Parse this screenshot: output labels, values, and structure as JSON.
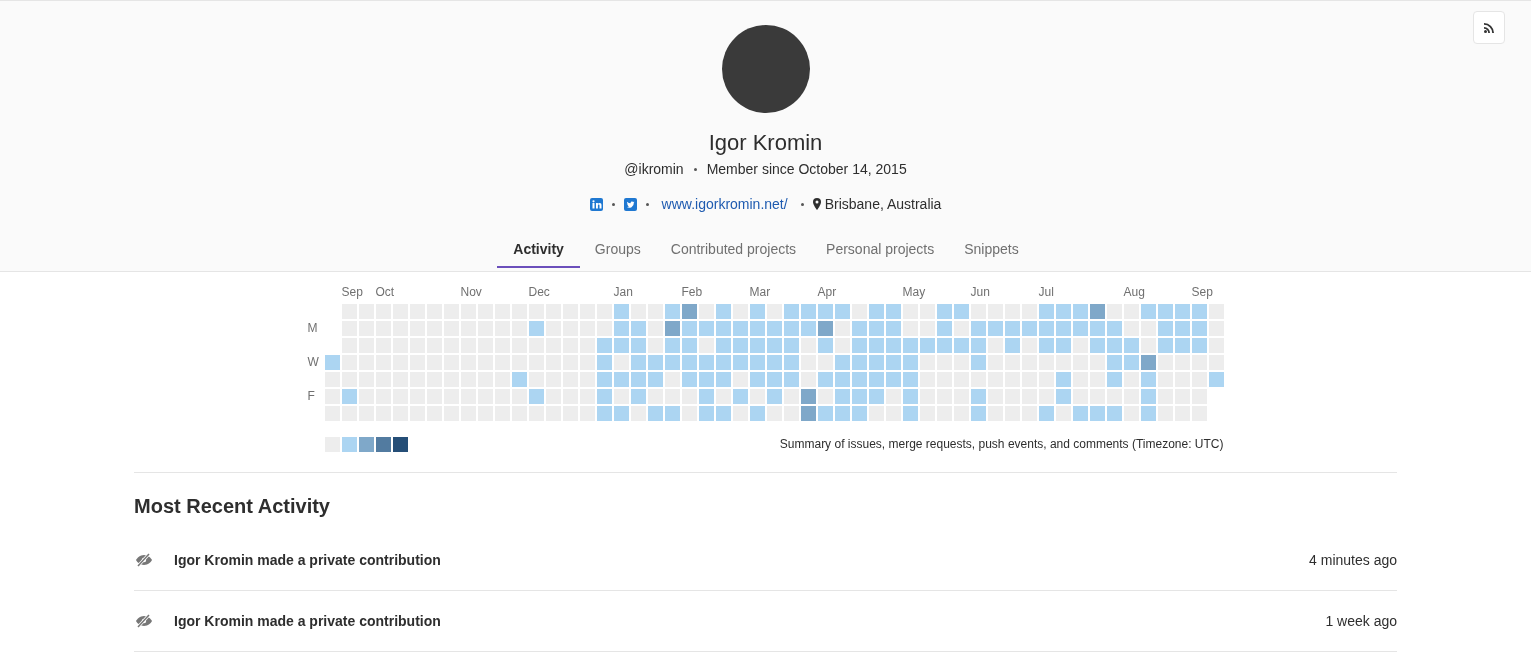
{
  "profile": {
    "name": "Igor Kromin",
    "username": "@ikromin",
    "member_since": "Member since October 14, 2015",
    "links": [
      {
        "kind": "linkedin"
      },
      {
        "kind": "twitter"
      },
      {
        "kind": "website",
        "text": "www.igorkromin.net/"
      },
      {
        "kind": "location",
        "text": "Brisbane, Australia"
      }
    ]
  },
  "tabs": [
    {
      "label": "Activity",
      "selected": true
    },
    {
      "label": "Groups",
      "selected": false
    },
    {
      "label": "Contributed projects",
      "selected": false
    },
    {
      "label": "Personal projects",
      "selected": false
    },
    {
      "label": "Snippets",
      "selected": false
    }
  ],
  "calendar": {
    "day_labels": [
      "M",
      "W",
      "F"
    ],
    "weeks": [
      {
        "days": [
          {
            "color": "#acd5f2"
          },
          {
            "color": "#ededed"
          },
          {
            "color": "#ededed"
          },
          {
            "color": "#ededed"
          }
        ]
      },
      {
        "month": "Sep",
        "days": [
          {
            "color": "#ededed"
          },
          {
            "color": "#ededed"
          },
          {
            "color": "#ededed"
          },
          {
            "color": "#ededed"
          },
          {
            "color": "#ededed"
          },
          {
            "color": "#acd5f2"
          },
          {
            "color": "#ededed"
          }
        ]
      },
      {
        "days": [
          {
            "color": "#ededed"
          },
          {
            "color": "#ededed"
          },
          {
            "color": "#ededed"
          },
          {
            "color": "#ededed"
          },
          {
            "color": "#ededed"
          },
          {
            "color": "#ededed"
          },
          {
            "color": "#ededed"
          }
        ]
      },
      {
        "month": "Oct",
        "days": [
          {
            "color": "#ededed"
          },
          {
            "color": "#ededed"
          },
          {
            "color": "#ededed"
          },
          {
            "color": "#ededed"
          },
          {
            "color": "#ededed"
          },
          {
            "color": "#ededed"
          },
          {
            "color": "#ededed"
          }
        ]
      },
      {
        "days": [
          {
            "color": "#ededed"
          },
          {
            "color": "#ededed"
          },
          {
            "color": "#ededed"
          },
          {
            "color": "#ededed"
          },
          {
            "color": "#ededed"
          },
          {
            "color": "#ededed"
          },
          {
            "color": "#ededed"
          }
        ]
      },
      {
        "days": [
          {
            "color": "#ededed"
          },
          {
            "color": "#ededed"
          },
          {
            "color": "#ededed"
          },
          {
            "color": "#ededed"
          },
          {
            "color": "#ededed"
          },
          {
            "color": "#ededed"
          },
          {
            "color": "#ededed"
          }
        ]
      },
      {
        "days": [
          {
            "color": "#ededed"
          },
          {
            "color": "#ededed"
          },
          {
            "color": "#ededed"
          },
          {
            "color": "#ededed"
          },
          {
            "color": "#ededed"
          },
          {
            "color": "#ededed"
          },
          {
            "color": "#ededed"
          }
        ]
      },
      {
        "days": [
          {
            "color": "#ededed"
          },
          {
            "color": "#ededed"
          },
          {
            "color": "#ededed"
          },
          {
            "color": "#ededed"
          },
          {
            "color": "#ededed"
          },
          {
            "color": "#ededed"
          },
          {
            "color": "#ededed"
          }
        ]
      },
      {
        "month": "Nov",
        "days": [
          {
            "color": "#ededed"
          },
          {
            "color": "#ededed"
          },
          {
            "color": "#ededed"
          },
          {
            "color": "#ededed"
          },
          {
            "color": "#ededed"
          },
          {
            "color": "#ededed"
          },
          {
            "color": "#ededed"
          }
        ]
      },
      {
        "days": [
          {
            "color": "#ededed"
          },
          {
            "color": "#ededed"
          },
          {
            "color": "#ededed"
          },
          {
            "color": "#ededed"
          },
          {
            "color": "#ededed"
          },
          {
            "color": "#ededed"
          },
          {
            "color": "#ededed"
          }
        ]
      },
      {
        "days": [
          {
            "color": "#ededed"
          },
          {
            "color": "#ededed"
          },
          {
            "color": "#ededed"
          },
          {
            "color": "#ededed"
          },
          {
            "color": "#ededed"
          },
          {
            "color": "#ededed"
          },
          {
            "color": "#ededed"
          }
        ]
      },
      {
        "days": [
          {
            "color": "#ededed"
          },
          {
            "color": "#ededed"
          },
          {
            "color": "#ededed"
          },
          {
            "color": "#ededed"
          },
          {
            "color": "#acd5f2"
          },
          {
            "color": "#ededed"
          },
          {
            "color": "#ededed"
          }
        ]
      },
      {
        "month": "Dec",
        "days": [
          {
            "color": "#ededed"
          },
          {
            "color": "#acd5f2"
          },
          {
            "color": "#ededed"
          },
          {
            "color": "#ededed"
          },
          {
            "color": "#ededed"
          },
          {
            "color": "#acd5f2"
          },
          {
            "color": "#ededed"
          }
        ]
      },
      {
        "days": [
          {
            "color": "#ededed"
          },
          {
            "color": "#ededed"
          },
          {
            "color": "#ededed"
          },
          {
            "color": "#ededed"
          },
          {
            "color": "#ededed"
          },
          {
            "color": "#ededed"
          },
          {
            "color": "#ededed"
          }
        ]
      },
      {
        "days": [
          {
            "color": "#ededed"
          },
          {
            "color": "#ededed"
          },
          {
            "color": "#ededed"
          },
          {
            "color": "#ededed"
          },
          {
            "color": "#ededed"
          },
          {
            "color": "#ededed"
          },
          {
            "color": "#ededed"
          }
        ]
      },
      {
        "days": [
          {
            "color": "#ededed"
          },
          {
            "color": "#ededed"
          },
          {
            "color": "#ededed"
          },
          {
            "color": "#ededed"
          },
          {
            "color": "#ededed"
          },
          {
            "color": "#ededed"
          },
          {
            "color": "#ededed"
          }
        ]
      },
      {
        "days": [
          {
            "color": "#ededed"
          },
          {
            "color": "#ededed"
          },
          {
            "color": "#acd5f2"
          },
          {
            "color": "#acd5f2"
          },
          {
            "color": "#acd5f2"
          },
          {
            "color": "#acd5f2"
          },
          {
            "color": "#acd5f2"
          }
        ]
      },
      {
        "month": "Jan",
        "days": [
          {
            "color": "#acd5f2"
          },
          {
            "color": "#acd5f2"
          },
          {
            "color": "#acd5f2"
          },
          {
            "color": "#ededed"
          },
          {
            "color": "#acd5f2"
          },
          {
            "color": "#ededed"
          },
          {
            "color": "#acd5f2"
          }
        ]
      },
      {
        "days": [
          {
            "color": "#ededed"
          },
          {
            "color": "#acd5f2"
          },
          {
            "color": "#acd5f2"
          },
          {
            "color": "#acd5f2"
          },
          {
            "color": "#acd5f2"
          },
          {
            "color": "#acd5f2"
          },
          {
            "color": "#ededed"
          }
        ]
      },
      {
        "days": [
          {
            "color": "#ededed"
          },
          {
            "color": "#ededed"
          },
          {
            "color": "#ededed"
          },
          {
            "color": "#acd5f2"
          },
          {
            "color": "#acd5f2"
          },
          {
            "color": "#ededed"
          },
          {
            "color": "#acd5f2"
          }
        ]
      },
      {
        "days": [
          {
            "color": "#acd5f2"
          },
          {
            "color": "#7fa8c9"
          },
          {
            "color": "#acd5f2"
          },
          {
            "color": "#acd5f2"
          },
          {
            "color": "#ededed"
          },
          {
            "color": "#ededed"
          },
          {
            "color": "#acd5f2"
          }
        ]
      },
      {
        "month": "Feb",
        "days": [
          {
            "color": "#7fa8c9"
          },
          {
            "color": "#acd5f2"
          },
          {
            "color": "#acd5f2"
          },
          {
            "color": "#acd5f2"
          },
          {
            "color": "#acd5f2"
          },
          {
            "color": "#ededed"
          },
          {
            "color": "#ededed"
          }
        ]
      },
      {
        "days": [
          {
            "color": "#ededed"
          },
          {
            "color": "#acd5f2"
          },
          {
            "color": "#ededed"
          },
          {
            "color": "#acd5f2"
          },
          {
            "color": "#acd5f2"
          },
          {
            "color": "#acd5f2"
          },
          {
            "color": "#acd5f2"
          }
        ]
      },
      {
        "days": [
          {
            "color": "#acd5f2"
          },
          {
            "color": "#acd5f2"
          },
          {
            "color": "#acd5f2"
          },
          {
            "color": "#acd5f2"
          },
          {
            "color": "#acd5f2"
          },
          {
            "color": "#ededed"
          },
          {
            "color": "#acd5f2"
          }
        ]
      },
      {
        "days": [
          {
            "color": "#ededed"
          },
          {
            "color": "#acd5f2"
          },
          {
            "color": "#acd5f2"
          },
          {
            "color": "#acd5f2"
          },
          {
            "color": "#ededed"
          },
          {
            "color": "#acd5f2"
          },
          {
            "color": "#ededed"
          }
        ]
      },
      {
        "month": "Mar",
        "days": [
          {
            "color": "#acd5f2"
          },
          {
            "color": "#acd5f2"
          },
          {
            "color": "#acd5f2"
          },
          {
            "color": "#acd5f2"
          },
          {
            "color": "#acd5f2"
          },
          {
            "color": "#ededed"
          },
          {
            "color": "#acd5f2"
          }
        ]
      },
      {
        "days": [
          {
            "color": "#ededed"
          },
          {
            "color": "#acd5f2"
          },
          {
            "color": "#acd5f2"
          },
          {
            "color": "#acd5f2"
          },
          {
            "color": "#acd5f2"
          },
          {
            "color": "#acd5f2"
          },
          {
            "color": "#ededed"
          }
        ]
      },
      {
        "days": [
          {
            "color": "#acd5f2"
          },
          {
            "color": "#acd5f2"
          },
          {
            "color": "#acd5f2"
          },
          {
            "color": "#acd5f2"
          },
          {
            "color": "#acd5f2"
          },
          {
            "color": "#ededed"
          },
          {
            "color": "#ededed"
          }
        ]
      },
      {
        "days": [
          {
            "color": "#acd5f2"
          },
          {
            "color": "#acd5f2"
          },
          {
            "color": "#ededed"
          },
          {
            "color": "#ededed"
          },
          {
            "color": "#ededed"
          },
          {
            "color": "#7fa8c9"
          },
          {
            "color": "#7fa8c9"
          }
        ]
      },
      {
        "month": "Apr",
        "days": [
          {
            "color": "#acd5f2"
          },
          {
            "color": "#7fa8c9"
          },
          {
            "color": "#acd5f2"
          },
          {
            "color": "#ededed"
          },
          {
            "color": "#acd5f2"
          },
          {
            "color": "#ededed"
          },
          {
            "color": "#acd5f2"
          }
        ]
      },
      {
        "days": [
          {
            "color": "#acd5f2"
          },
          {
            "color": "#ededed"
          },
          {
            "color": "#ededed"
          },
          {
            "color": "#acd5f2"
          },
          {
            "color": "#acd5f2"
          },
          {
            "color": "#acd5f2"
          },
          {
            "color": "#acd5f2"
          }
        ]
      },
      {
        "days": [
          {
            "color": "#ededed"
          },
          {
            "color": "#acd5f2"
          },
          {
            "color": "#acd5f2"
          },
          {
            "color": "#acd5f2"
          },
          {
            "color": "#acd5f2"
          },
          {
            "color": "#acd5f2"
          },
          {
            "color": "#acd5f2"
          }
        ]
      },
      {
        "days": [
          {
            "color": "#acd5f2"
          },
          {
            "color": "#acd5f2"
          },
          {
            "color": "#acd5f2"
          },
          {
            "color": "#acd5f2"
          },
          {
            "color": "#acd5f2"
          },
          {
            "color": "#acd5f2"
          },
          {
            "color": "#ededed"
          }
        ]
      },
      {
        "days": [
          {
            "color": "#acd5f2"
          },
          {
            "color": "#acd5f2"
          },
          {
            "color": "#acd5f2"
          },
          {
            "color": "#acd5f2"
          },
          {
            "color": "#acd5f2"
          },
          {
            "color": "#ededed"
          },
          {
            "color": "#ededed"
          }
        ]
      },
      {
        "month": "May",
        "days": [
          {
            "color": "#ededed"
          },
          {
            "color": "#ededed"
          },
          {
            "color": "#acd5f2"
          },
          {
            "color": "#acd5f2"
          },
          {
            "color": "#acd5f2"
          },
          {
            "color": "#acd5f2"
          },
          {
            "color": "#acd5f2"
          }
        ]
      },
      {
        "days": [
          {
            "color": "#ededed"
          },
          {
            "color": "#ededed"
          },
          {
            "color": "#acd5f2"
          },
          {
            "color": "#ededed"
          },
          {
            "color": "#ededed"
          },
          {
            "color": "#ededed"
          },
          {
            "color": "#ededed"
          }
        ]
      },
      {
        "days": [
          {
            "color": "#acd5f2"
          },
          {
            "color": "#acd5f2"
          },
          {
            "color": "#acd5f2"
          },
          {
            "color": "#ededed"
          },
          {
            "color": "#ededed"
          },
          {
            "color": "#ededed"
          },
          {
            "color": "#ededed"
          }
        ]
      },
      {
        "days": [
          {
            "color": "#acd5f2"
          },
          {
            "color": "#ededed"
          },
          {
            "color": "#acd5f2"
          },
          {
            "color": "#ededed"
          },
          {
            "color": "#ededed"
          },
          {
            "color": "#ededed"
          },
          {
            "color": "#ededed"
          }
        ]
      },
      {
        "month": "Jun",
        "days": [
          {
            "color": "#ededed"
          },
          {
            "color": "#acd5f2"
          },
          {
            "color": "#acd5f2"
          },
          {
            "color": "#acd5f2"
          },
          {
            "color": "#ededed"
          },
          {
            "color": "#acd5f2"
          },
          {
            "color": "#acd5f2"
          }
        ]
      },
      {
        "days": [
          {
            "color": "#ededed"
          },
          {
            "color": "#acd5f2"
          },
          {
            "color": "#ededed"
          },
          {
            "color": "#ededed"
          },
          {
            "color": "#ededed"
          },
          {
            "color": "#ededed"
          },
          {
            "color": "#ededed"
          }
        ]
      },
      {
        "days": [
          {
            "color": "#ededed"
          },
          {
            "color": "#acd5f2"
          },
          {
            "color": "#acd5f2"
          },
          {
            "color": "#ededed"
          },
          {
            "color": "#ededed"
          },
          {
            "color": "#ededed"
          },
          {
            "color": "#ededed"
          }
        ]
      },
      {
        "days": [
          {
            "color": "#ededed"
          },
          {
            "color": "#acd5f2"
          },
          {
            "color": "#ededed"
          },
          {
            "color": "#ededed"
          },
          {
            "color": "#ededed"
          },
          {
            "color": "#ededed"
          },
          {
            "color": "#ededed"
          }
        ]
      },
      {
        "month": "Jul",
        "days": [
          {
            "color": "#acd5f2"
          },
          {
            "color": "#acd5f2"
          },
          {
            "color": "#acd5f2"
          },
          {
            "color": "#ededed"
          },
          {
            "color": "#ededed"
          },
          {
            "color": "#ededed"
          },
          {
            "color": "#acd5f2"
          }
        ]
      },
      {
        "days": [
          {
            "color": "#acd5f2"
          },
          {
            "color": "#acd5f2"
          },
          {
            "color": "#acd5f2"
          },
          {
            "color": "#ededed"
          },
          {
            "color": "#acd5f2"
          },
          {
            "color": "#acd5f2"
          },
          {
            "color": "#ededed"
          }
        ]
      },
      {
        "days": [
          {
            "color": "#acd5f2"
          },
          {
            "color": "#acd5f2"
          },
          {
            "color": "#ededed"
          },
          {
            "color": "#ededed"
          },
          {
            "color": "#ededed"
          },
          {
            "color": "#ededed"
          },
          {
            "color": "#acd5f2"
          }
        ]
      },
      {
        "days": [
          {
            "color": "#7fa8c9"
          },
          {
            "color": "#acd5f2"
          },
          {
            "color": "#acd5f2"
          },
          {
            "color": "#ededed"
          },
          {
            "color": "#ededed"
          },
          {
            "color": "#ededed"
          },
          {
            "color": "#acd5f2"
          }
        ]
      },
      {
        "days": [
          {
            "color": "#ededed"
          },
          {
            "color": "#acd5f2"
          },
          {
            "color": "#acd5f2"
          },
          {
            "color": "#acd5f2"
          },
          {
            "color": "#acd5f2"
          },
          {
            "color": "#ededed"
          },
          {
            "color": "#acd5f2"
          }
        ]
      },
      {
        "month": "Aug",
        "days": [
          {
            "color": "#ededed"
          },
          {
            "color": "#ededed"
          },
          {
            "color": "#acd5f2"
          },
          {
            "color": "#acd5f2"
          },
          {
            "color": "#ededed"
          },
          {
            "color": "#ededed"
          },
          {
            "color": "#ededed"
          }
        ]
      },
      {
        "days": [
          {
            "color": "#acd5f2"
          },
          {
            "color": "#ededed"
          },
          {
            "color": "#ededed"
          },
          {
            "color": "#7fa8c9"
          },
          {
            "color": "#acd5f2"
          },
          {
            "color": "#acd5f2"
          },
          {
            "color": "#acd5f2"
          }
        ]
      },
      {
        "days": [
          {
            "color": "#acd5f2"
          },
          {
            "color": "#acd5f2"
          },
          {
            "color": "#acd5f2"
          },
          {
            "color": "#ededed"
          },
          {
            "color": "#ededed"
          },
          {
            "color": "#ededed"
          },
          {
            "color": "#ededed"
          }
        ]
      },
      {
        "days": [
          {
            "color": "#acd5f2"
          },
          {
            "color": "#acd5f2"
          },
          {
            "color": "#acd5f2"
          },
          {
            "color": "#ededed"
          },
          {
            "color": "#ededed"
          },
          {
            "color": "#ededed"
          },
          {
            "color": "#ededed"
          }
        ]
      },
      {
        "month": "Sep",
        "days": [
          {
            "color": "#acd5f2"
          },
          {
            "color": "#acd5f2"
          },
          {
            "color": "#acd5f2"
          },
          {
            "color": "#ededed"
          },
          {
            "color": "#ededed"
          },
          {
            "color": "#ededed"
          },
          {
            "color": "#ededed"
          }
        ]
      },
      {
        "days": [
          {
            "color": "#ededed"
          },
          {
            "color": "#ededed"
          },
          {
            "color": "#ededed"
          },
          {
            "color": "#ededed"
          },
          {
            "color": "#acd5f2"
          }
        ]
      }
    ],
    "legend": [
      {
        "color": "#ededed"
      },
      {
        "color": "#acd5f2"
      },
      {
        "color": "#7fa8c9"
      },
      {
        "color": "#527ba0"
      },
      {
        "color": "#254e77"
      }
    ],
    "summary": "Summary of issues, merge requests, push events, and comments (Timezone: UTC)"
  },
  "recent_activity": {
    "title": "Most Recent Activity",
    "events": [
      {
        "text": "Igor Kromin made a private contribution",
        "time": "4 minutes ago"
      },
      {
        "text": "Igor Kromin made a private contribution",
        "time": "1 week ago"
      }
    ]
  }
}
